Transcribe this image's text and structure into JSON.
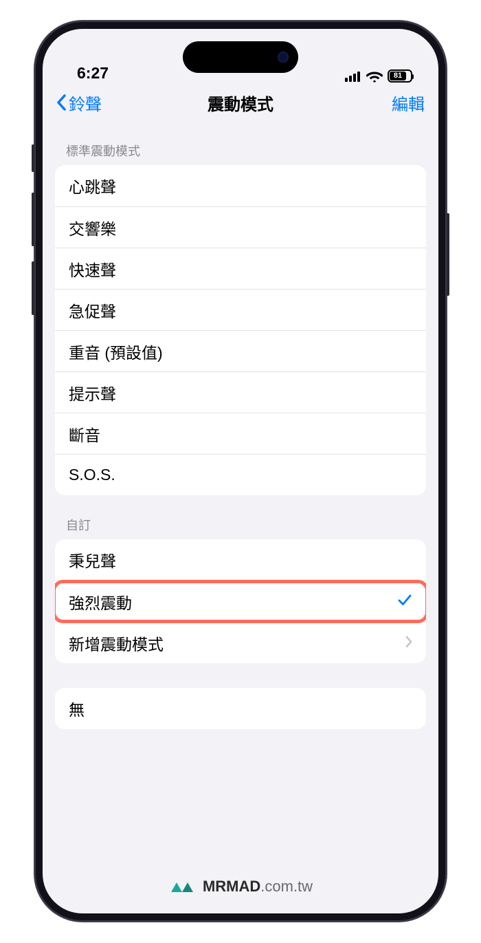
{
  "status": {
    "time": "6:27",
    "battery_percent": "81"
  },
  "nav": {
    "back_label": "鈴聲",
    "title": "震動模式",
    "edit_label": "編輯"
  },
  "sections": {
    "standard_header": "標準震動模式",
    "standard_items": {
      "heartbeat": "心跳聲",
      "symphony": "交響樂",
      "rapid": "快速聲",
      "quick": "急促聲",
      "accent_default": "重音 (預設值)",
      "alert": "提示聲",
      "staccato": "斷音",
      "sos": "S.O.S."
    },
    "custom_header": "自訂",
    "custom_items": {
      "item1": "秉兒聲",
      "strong": "強烈震動",
      "create_new": "新增震動模式"
    },
    "none_items": {
      "none": "無"
    }
  },
  "selected": "強烈震動",
  "watermark": {
    "bold": "MRMAD",
    "rest": ".com.tw"
  }
}
